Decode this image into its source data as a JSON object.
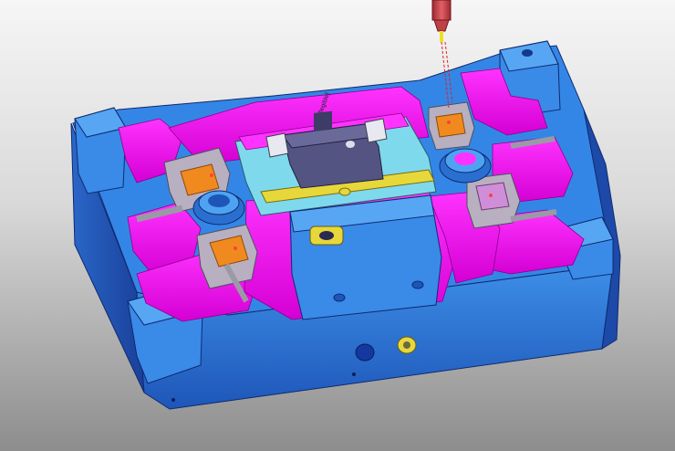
{
  "viewport": {
    "background_top": "#f6f6f6",
    "background_bottom": "#8d8d8d"
  },
  "model": {
    "base_color": "#2f7fe0",
    "base_dark": "#1a3f9a",
    "base_light": "#4da3f2",
    "parting_surface_color": "#ff00ff",
    "insert_color": "#7fd9ec",
    "core_block_color": "#545482",
    "accent_orange": "#f08a1e",
    "accent_yellow": "#e6d83a",
    "slider_grey": "#9a9aa6"
  },
  "tool": {
    "name": "end-mill-tool",
    "holder_color": "#d0404a",
    "tip_color": "#f0e020",
    "toolpath_color": "#e02020"
  },
  "engraving_text": "[illegible]"
}
